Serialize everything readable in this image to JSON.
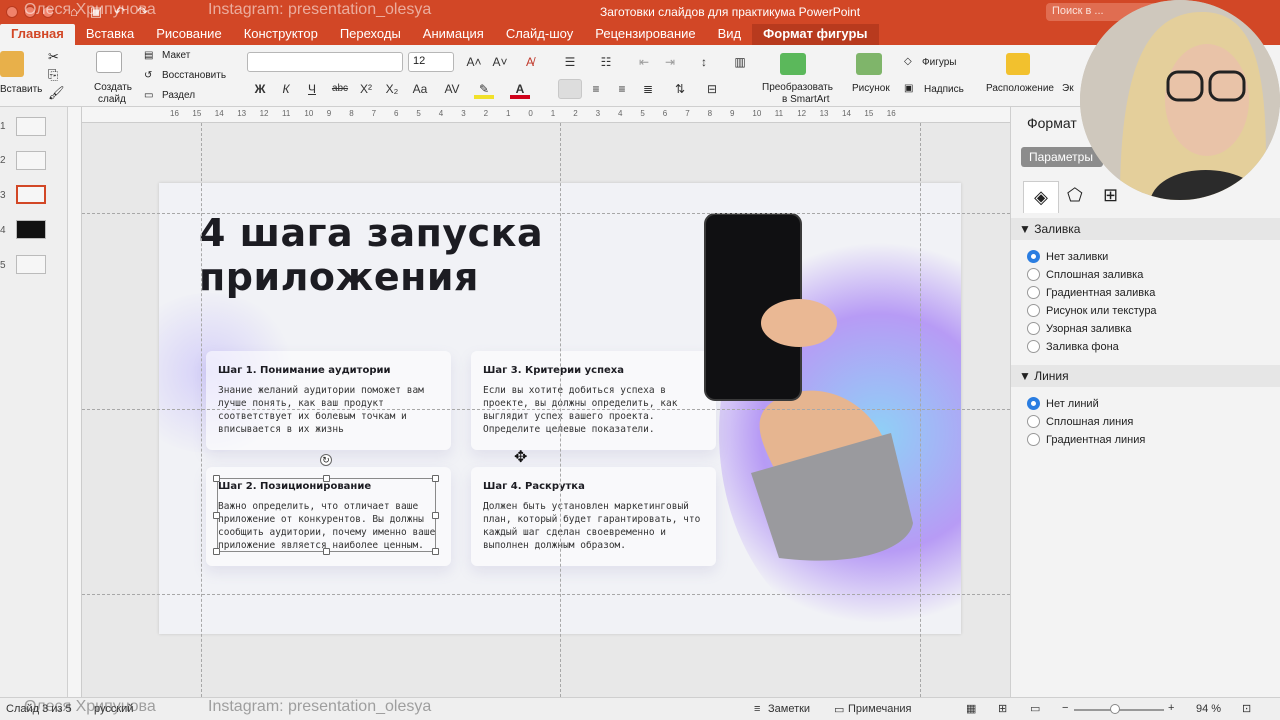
{
  "window": {
    "document_title": "Заготовки слайдов для практикума PowerPoint",
    "search_placeholder": "Поиск в ...",
    "watermark_name": "Олеся Хрипунова",
    "watermark_insta": "Instagram: presentation_olesya"
  },
  "tabs": [
    "Главная",
    "Вставка",
    "Рисование",
    "Конструктор",
    "Переходы",
    "Анимация",
    "Слайд-шоу",
    "Рецензирование",
    "Вид",
    "Формат фигуры"
  ],
  "ribbon": {
    "paste_label": "Вставить",
    "new_slide_label_1": "Создать",
    "new_slide_label_2": "слайд",
    "layout_label": "Макет",
    "reset_label": "Восстановить",
    "section_label": "Раздел",
    "font_name": "",
    "font_size": "12",
    "bold": "Ж",
    "italic": "К",
    "underline": "Ч",
    "strike": "abc",
    "superscript": "X²",
    "subscript": "X₂",
    "smartart_1": "Преобразовать",
    "smartart_2": "в SmartArt",
    "picture_label": "Рисунок",
    "shapes_label": "Фигуры",
    "textbox_label": "Надпись",
    "arrange_label": "Расположение",
    "extra_label": "Эк"
  },
  "thumbnails": [
    "1",
    "2",
    "3",
    "4",
    "5"
  ],
  "selected_slide": 3,
  "ruler_ticks": [
    "16",
    "15",
    "14",
    "13",
    "12",
    "11",
    "10",
    "9",
    "8",
    "7",
    "6",
    "5",
    "4",
    "3",
    "2",
    "1",
    "0",
    "1",
    "2",
    "3",
    "4",
    "5",
    "6",
    "7",
    "8",
    "9",
    "10",
    "11",
    "12",
    "13",
    "14",
    "15",
    "16"
  ],
  "slide": {
    "title_line1": "4 шага запуска",
    "title_line2": "приложения",
    "cards": [
      {
        "title": "Шаг 1. Понимание аудитории",
        "body": "Знание желаний аудитории поможет вам лучше понять, как ваш продукт соответствует их болевым точкам и вписывается в их жизнь"
      },
      {
        "title": "Шаг 3. Критерии успеха",
        "body": "Если вы хотите добиться успеха в проекте, вы должны определить, как выглядит успех вашего проекта. Определите целевые показатели."
      },
      {
        "title": "Шаг 2. Позиционирование",
        "body": "Важно определить, что отличает ваше приложение от конкурентов. Вы должны сообщить аудитории, почему именно ваше приложение является наиболее ценным."
      },
      {
        "title": "Шаг 4. Раскрутка",
        "body": "Должен быть установлен маркетинговый план, который будет гарантировать, что каждый шаг сделан своевременно и выполнен должным образом."
      }
    ]
  },
  "pane": {
    "title": "Формат",
    "params_button": "Параметры",
    "fill_section": "Заливка",
    "fill_options": [
      "Нет заливки",
      "Сплошная заливка",
      "Градиентная заливка",
      "Рисунок или текстура",
      "Узорная заливка",
      "Заливка фона"
    ],
    "fill_selected": 0,
    "line_section": "Линия",
    "line_options": [
      "Нет линий",
      "Сплошная линия",
      "Градиентная линия"
    ],
    "line_selected": 0
  },
  "status": {
    "slide_info": "Слайд 3 из 5",
    "language": "русский",
    "notes": "Заметки",
    "comments": "Примечания",
    "zoom": "94 %"
  },
  "colors": {
    "accent": "#d24726",
    "radio": "#2a7de1"
  }
}
